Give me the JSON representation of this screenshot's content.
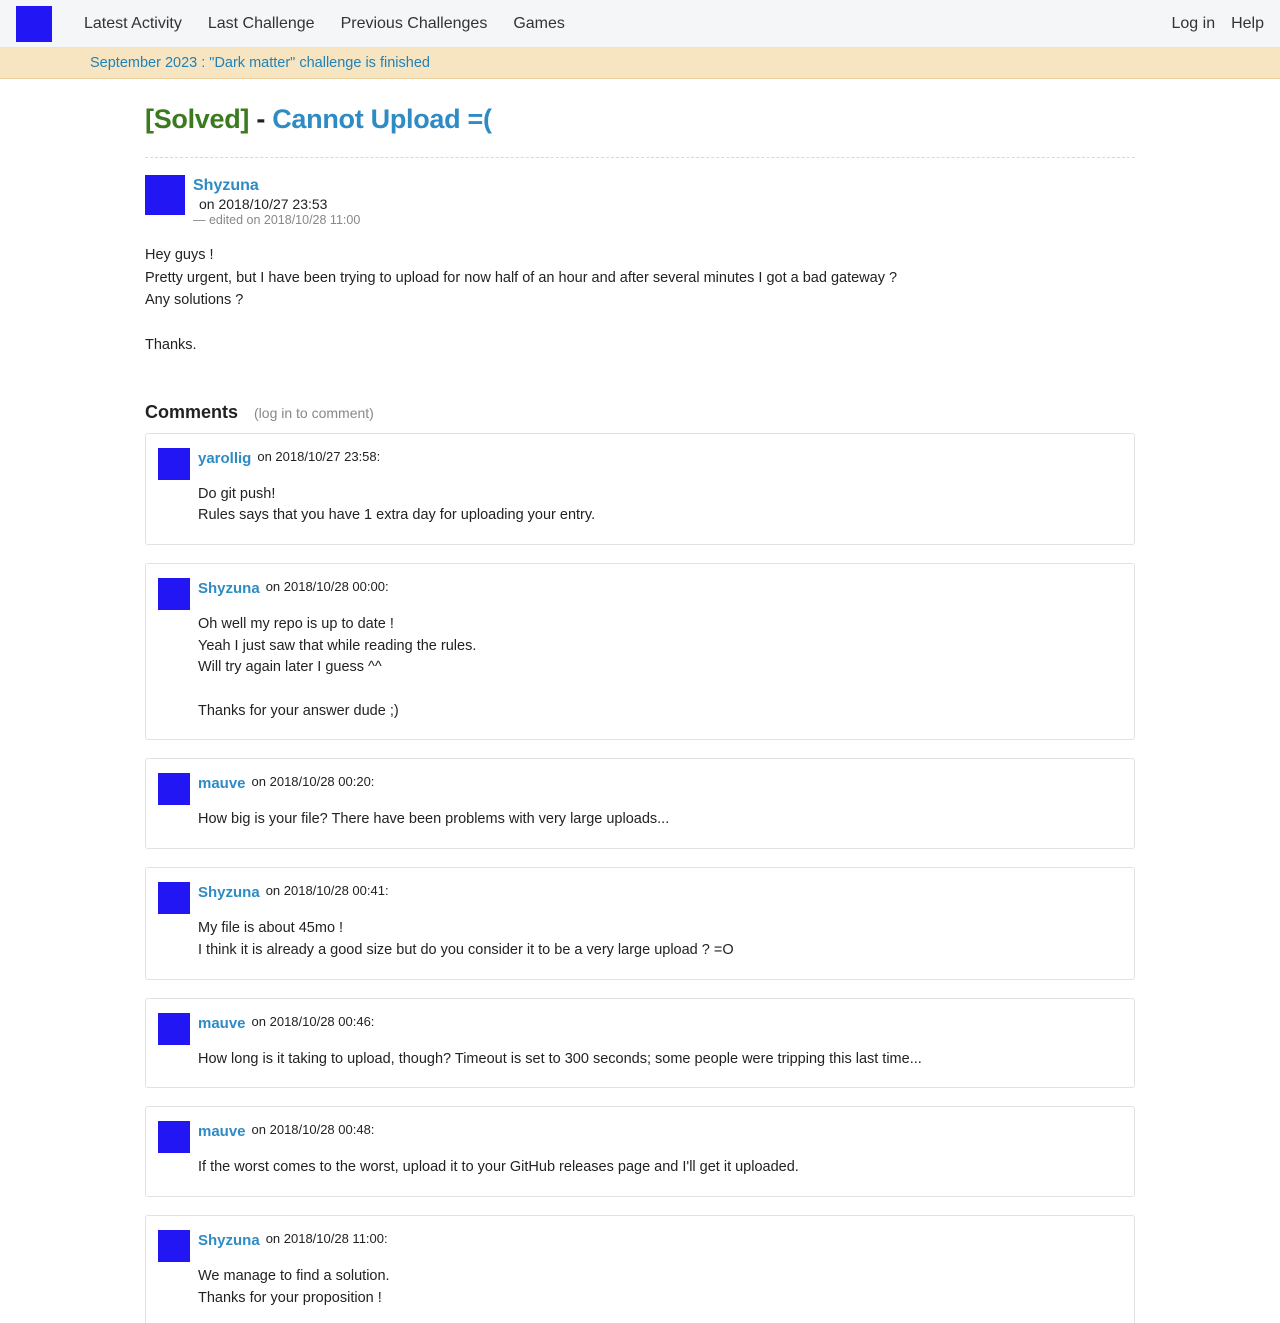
{
  "nav": {
    "links": [
      "Latest Activity",
      "Last Challenge",
      "Previous Challenges",
      "Games"
    ],
    "right": [
      "Log in",
      "Help"
    ]
  },
  "banner": "September 2023 : \"Dark matter\" challenge is finished",
  "post": {
    "status": "[Solved]",
    "separator": "-",
    "title": "Cannot Upload =(",
    "author": "Shyzuna",
    "date": "on 2018/10/27 23:53",
    "edited": "— edited on 2018/10/28 11:00",
    "body": [
      "Hey guys !",
      "Pretty urgent, but I have been trying to upload for now half of an hour and after several minutes I got a bad gateway ?",
      "Any solutions ?",
      "",
      "Thanks."
    ]
  },
  "comments_section": {
    "title": "Comments",
    "login_note": "(log in to comment)"
  },
  "comments": [
    {
      "author": "yarollig",
      "date": "on 2018/10/27 23:58:",
      "lines": [
        "Do git push!",
        "Rules says that you have 1 extra day for uploading your entry."
      ]
    },
    {
      "author": "Shyzuna",
      "date": "on 2018/10/28 00:00:",
      "lines": [
        "Oh well my repo is up to date !",
        "Yeah I just saw that while reading the rules.",
        "Will try again later I guess ^^",
        "",
        "Thanks for your answer dude ;)"
      ]
    },
    {
      "author": "mauve",
      "date": "on 2018/10/28 00:20:",
      "lines": [
        "How big is your file? There have been problems with very large uploads..."
      ]
    },
    {
      "author": "Shyzuna",
      "date": "on 2018/10/28 00:41:",
      "lines": [
        "My file is about 45mo !",
        "I think it is already a good size but do you consider it to be a very large upload ? =O"
      ]
    },
    {
      "author": "mauve",
      "date": "on 2018/10/28 00:46:",
      "lines": [
        "How long is it taking to upload, though? Timeout is set to 300 seconds; some people were tripping this last time..."
      ]
    },
    {
      "author": "mauve",
      "date": "on 2018/10/28 00:48:",
      "lines": [
        "If the worst comes to the worst, upload it to your GitHub releases page and I'll get it uploaded."
      ]
    },
    {
      "author": "Shyzuna",
      "date": "on 2018/10/28 11:00:",
      "lines": [
        "We manage to find a solution.",
        "Thanks for your proposition !"
      ]
    }
  ]
}
